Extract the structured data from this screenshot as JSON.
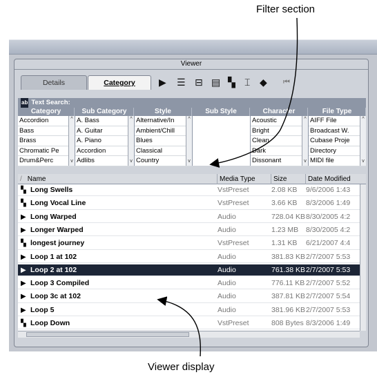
{
  "callouts": {
    "top": "Filter section",
    "bottom": "Viewer display"
  },
  "viewer": {
    "title": "Viewer",
    "tabs": [
      "Details",
      "Category"
    ],
    "search_label": "Text Search:",
    "search_badge": "ab"
  },
  "filters": [
    {
      "header": "Category",
      "items": [
        "Accordion",
        "Bass",
        "Brass",
        "Chromatic Pe",
        "Drum&Perc"
      ]
    },
    {
      "header": "Sub Category",
      "items": [
        "A. Bass",
        "A. Guitar",
        "A. Piano",
        "Accordion",
        "Adlibs"
      ]
    },
    {
      "header": "Style",
      "items": [
        "Alternative/In",
        "Ambient/Chill",
        "Blues",
        "Classical",
        "Country"
      ]
    },
    {
      "header": "Sub Style",
      "items": [
        "",
        "",
        "",
        "",
        ""
      ]
    },
    {
      "header": "Character",
      "items": [
        "Acoustic",
        "Bright",
        "Clean",
        "Dark",
        "Dissonant"
      ]
    },
    {
      "header": "File Type",
      "items": [
        "AIFF File",
        "Broadcast W.",
        "Cubase Proje",
        "Directory",
        "MIDI file"
      ]
    }
  ],
  "list": {
    "columns": [
      "Name",
      "Media Type",
      "Size",
      "Date Modified"
    ],
    "rows": [
      {
        "icon": "preset-icon",
        "name": "Long Swells",
        "type": "VstPreset",
        "size": "2.08 KB",
        "date": "9/6/2006 1:43"
      },
      {
        "icon": "preset-icon",
        "name": "Long Vocal Line",
        "type": "VstPreset",
        "size": "3.66 KB",
        "date": "8/3/2006 1:49"
      },
      {
        "icon": "audio-icon",
        "name": "Long Warped",
        "type": "Audio",
        "size": "728.04 KB",
        "date": "8/30/2005 4:2"
      },
      {
        "icon": "audio-icon",
        "name": "Longer Warped",
        "type": "Audio",
        "size": "1.23 MB",
        "date": "8/30/2005 4:2"
      },
      {
        "icon": "preset-icon",
        "name": "longest journey",
        "type": "VstPreset",
        "size": "1.31 KB",
        "date": "6/21/2007 4:4"
      },
      {
        "icon": "audio-icon",
        "name": "Loop 1 at 102",
        "type": "Audio",
        "size": "381.83 KB",
        "date": "2/7/2007 5:53"
      },
      {
        "icon": "audio-icon",
        "name": "Loop 2 at 102",
        "type": "Audio",
        "size": "761.38 KB",
        "date": "2/7/2007 5:53",
        "selected": true
      },
      {
        "icon": "audio-icon",
        "name": "Loop 3 Compiled",
        "type": "Audio",
        "size": "776.11 KB",
        "date": "2/7/2007 5:52"
      },
      {
        "icon": "audio-icon",
        "name": "Loop 3c at 102",
        "type": "Audio",
        "size": "387.81 KB",
        "date": "2/7/2007 5:54"
      },
      {
        "icon": "audio-icon",
        "name": "Loop 5",
        "type": "Audio",
        "size": "381.96 KB",
        "date": "2/7/2007 5:53"
      },
      {
        "icon": "preset-icon",
        "name": "Loop Down",
        "type": "VstPreset",
        "size": "808 Bytes",
        "date": "8/3/2006 1:49"
      }
    ]
  }
}
